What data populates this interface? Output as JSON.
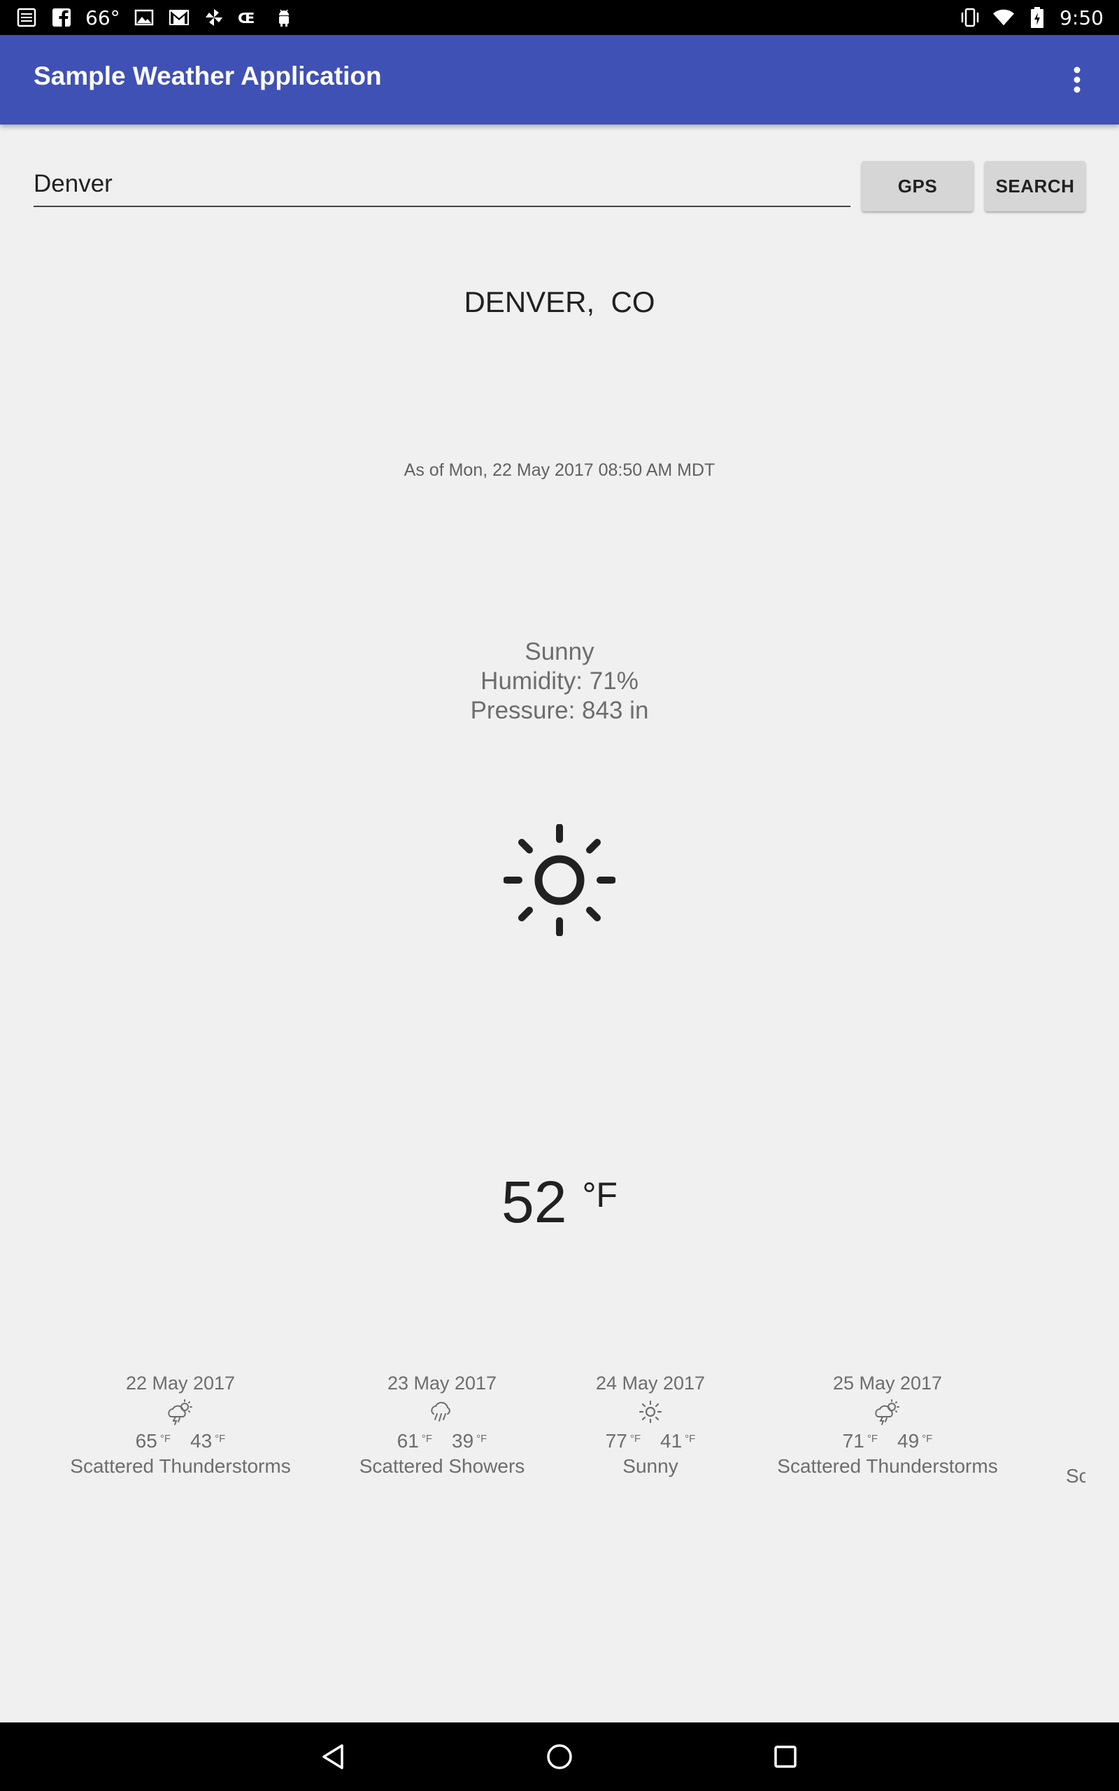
{
  "status_bar": {
    "temperature": "66°",
    "time": "9:50",
    "left_icons": [
      "bible-icon",
      "facebook-icon",
      "image-icon",
      "gmail-icon",
      "pinwheel-icon",
      "app-icon",
      "android-icon"
    ],
    "right_icons": [
      "vibrate-icon",
      "wifi-icon",
      "battery-icon"
    ]
  },
  "app_bar": {
    "title": "Sample Weather Application",
    "menu_icon": "overflow-menu-icon",
    "color": "#3f51b5"
  },
  "search": {
    "value": "Denver",
    "gps_label": "GPS",
    "search_label": "SEARCH"
  },
  "current": {
    "city": "DENVER,  CO",
    "as_of": "As of Mon, 22 May 2017 08:50 AM MDT",
    "condition": "Sunny",
    "humidity": "Humidity: 71%",
    "pressure": "Pressure: 843 in",
    "icon": "sun-icon",
    "temperature": "52",
    "unit": "°F"
  },
  "forecast": [
    {
      "date": "22 May 2017",
      "icon": "thunderstorm-icon",
      "high": "65",
      "low": "43",
      "unit": "°F",
      "desc": "Scattered Thunderstorms"
    },
    {
      "date": "23 May 2017",
      "icon": "showers-icon",
      "high": "61",
      "low": "39",
      "unit": "°F",
      "desc": "Scattered Showers"
    },
    {
      "date": "24 May 2017",
      "icon": "sun-icon",
      "high": "77",
      "low": "41",
      "unit": "°F",
      "desc": "Sunny"
    },
    {
      "date": "25 May 2017",
      "icon": "thunderstorm-icon",
      "high": "71",
      "low": "49",
      "unit": "°F",
      "desc": "Scattered Thunderstorms"
    }
  ],
  "forecast_partial": "Sc",
  "nav_bar": [
    "back-icon",
    "home-icon",
    "recents-icon"
  ]
}
